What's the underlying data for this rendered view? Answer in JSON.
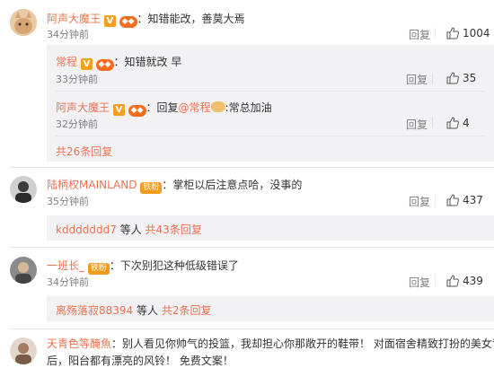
{
  "comments": [
    {
      "user": "阿声大魔王",
      "sep": "：",
      "text": "知错能改，善莫大焉",
      "time": "34分钟前",
      "reply": "回复",
      "likes": "1004",
      "replies": [
        {
          "user": "常程",
          "sep": "：",
          "text": "知错就改 早",
          "time": "33分钟前",
          "reply": "回复",
          "likes": "35"
        },
        {
          "user": "阿声大魔王",
          "sep": "：",
          "reply_prefix": "回复",
          "mention": "@常程",
          "text": ":常总加油",
          "time": "32分钟前",
          "reply": "回复",
          "likes": "4"
        }
      ],
      "more": "共26条回复"
    },
    {
      "user": "陆柄权MAINLAND",
      "badge": "铁粉",
      "sep": "：",
      "text": "掌柜以后注意点哈，没事的",
      "time": "35分钟前",
      "reply": "回复",
      "likes": "437",
      "sub_user": "kddddddd7",
      "sub_mid": " 等人 ",
      "sub_more": "共43条回复"
    },
    {
      "user": "一班长_",
      "badge": "铁粉",
      "sep": "：",
      "text": "下次别犯这种低级错误了",
      "time": "34分钟前",
      "reply": "回复",
      "likes": "439",
      "sub_user": "离殇落寂88394",
      "sub_mid": " 等人 ",
      "sub_more": "共2条回复"
    },
    {
      "user": "天青色等醃魚",
      "sep": "：",
      "text_line1": "别人看见你帅气的投篮，我却担心你那敞开的鞋带！ 对面宿舍精致打扮的美女背",
      "text_line2": "后，阳台都有漂亮的风铃！ 免费文案！"
    }
  ],
  "colors": {
    "accent": "#eb7350",
    "subbox": "#f2f2f5"
  }
}
